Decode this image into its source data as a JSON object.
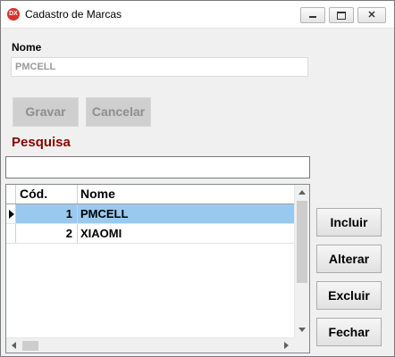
{
  "window": {
    "title": "Cadastro de Marcas",
    "app_icon_text": "DX",
    "close_glyph": "✕"
  },
  "form": {
    "nome_label": "Nome",
    "nome_value": "PMCELL",
    "gravar_label": "Gravar",
    "cancelar_label": "Cancelar",
    "pesquisa_label": "Pesquisa",
    "pesquisa_value": ""
  },
  "grid": {
    "columns": [
      "Cód.",
      "Nome"
    ],
    "rows": [
      {
        "cod": "1",
        "nome": "PMCELL",
        "selected": true
      },
      {
        "cod": "2",
        "nome": "XIAOMI",
        "selected": false
      }
    ]
  },
  "actions": {
    "incluir_label": "Incluir",
    "alterar_label": "Alterar",
    "excluir_label": "Excluir",
    "fechar_label": "Fechar"
  },
  "colors": {
    "pesquisa_label": "#8b0000",
    "selected_row": "#99c9ef",
    "disabled_button": "#cfcfcf"
  }
}
